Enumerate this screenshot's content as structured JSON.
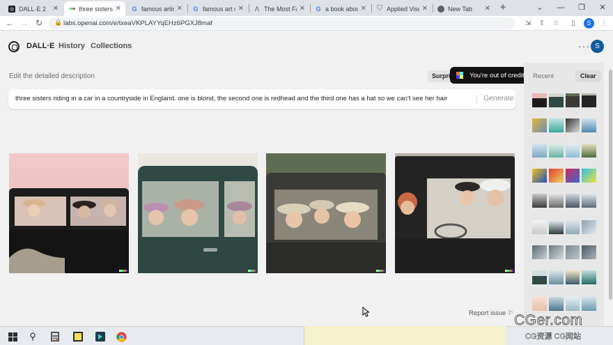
{
  "browser": {
    "tabs": [
      {
        "title": "DALL·E 2",
        "favicon": "openai-icon",
        "active": false
      },
      {
        "title": "three sisters",
        "favicon": "dalle-icon",
        "active": true
      },
      {
        "title": "famous artist",
        "favicon": "google-icon",
        "active": false
      },
      {
        "title": "famous art st",
        "favicon": "google-icon",
        "active": false
      },
      {
        "title": "The Most Fam",
        "favicon": "site-icon",
        "active": false
      },
      {
        "title": "a book about",
        "favicon": "google-icon",
        "active": false
      },
      {
        "title": "Applied Visua",
        "favicon": "shield-icon",
        "active": false
      },
      {
        "title": "New Tab",
        "favicon": "chrome-icon",
        "active": false
      }
    ],
    "new_tab_label": "+",
    "url": "labs.openai.com/e/txeaVKPLAYYqEHz6PGXJ8maf",
    "profile_initial": "S"
  },
  "app": {
    "brand": "DALL·E",
    "nav": [
      "History",
      "Collections"
    ],
    "more_label": "···",
    "avatar_initial": "S"
  },
  "editor": {
    "label": "Edit the detailed description",
    "surprise_label": "Surprise me",
    "toast": "You're out of credits",
    "prompt": "three sisters riding in a car in a countryside in England. one is blond, the second one is redhead and the third one has a hat so we can't see her hair",
    "generate_label": "Generate",
    "report_label": "Report issue"
  },
  "recent": {
    "title": "Recent",
    "clear_label": "Clear"
  },
  "watermark": {
    "main": "CGer.com",
    "sub": "CG资源 CG网站"
  },
  "colors": {
    "accent_blue": "#105a9e",
    "toast_bg": "#111111",
    "dalle_signature": [
      "#ffff66",
      "#42ffff",
      "#51da4c",
      "#ff6e3c",
      "#3c46ff"
    ]
  }
}
